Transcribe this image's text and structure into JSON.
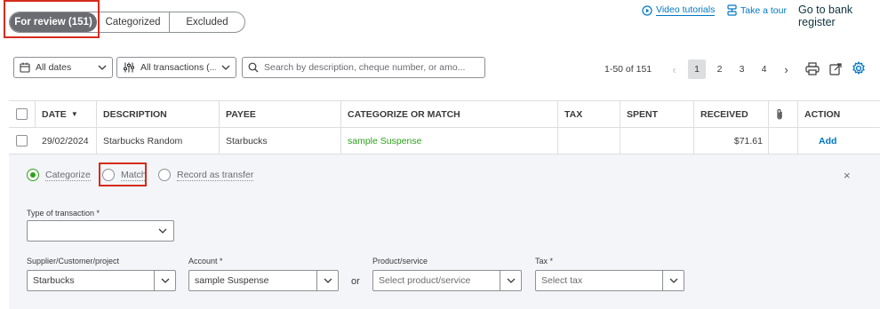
{
  "tabs": [
    {
      "label": "For review (151)"
    },
    {
      "label": "Categorized"
    },
    {
      "label": "Excluded"
    }
  ],
  "header_links": {
    "video_tutorials": "Video tutorials",
    "take_tour": "Take a tour",
    "go_to_bank_register": "Go to bank register"
  },
  "filters": {
    "dates": "All dates",
    "transactions": "All transactions (...",
    "search_placeholder": "Search by description, cheque number, or amo..."
  },
  "pagination": {
    "range": "1-50 of 151",
    "prev": "‹",
    "pages": [
      "1",
      "2",
      "3",
      "4"
    ],
    "current_page": "1",
    "next": "›"
  },
  "table": {
    "columns": {
      "date": "DATE",
      "sort": "▼",
      "description": "DESCRIPTION",
      "payee": "PAYEE",
      "categorize": "CATEGORIZE OR MATCH",
      "tax": "TAX",
      "spent": "SPENT",
      "received": "RECEIVED",
      "action": "ACTION"
    },
    "rows": [
      {
        "date": "29/02/2024",
        "description": "Starbucks Random",
        "payee": "Starbucks",
        "category": "sample Suspense",
        "tax": "",
        "spent": "",
        "received": "$71.61",
        "action": "Add"
      }
    ]
  },
  "panel": {
    "options": [
      "Categorize",
      "Match",
      "Record as transfer"
    ],
    "selected_option": "Categorize",
    "close": "×",
    "type_label": "Type of transaction *",
    "type_value": "",
    "supplier_label": "Supplier/Customer/project",
    "supplier_value": "Starbucks",
    "account_label": "Account *",
    "account_value": "sample Suspense",
    "or_text": "or",
    "product_label": "Product/service",
    "product_placeholder": "Select product/service",
    "tax_label": "Tax *",
    "tax_placeholder": "Select tax"
  },
  "colors": {
    "accent_green": "#2ca01c",
    "link_blue": "#0077c5",
    "highlight_red": "#d52b1e",
    "active_tab": "#6b6c72",
    "panel_bg": "#f4f5f8"
  }
}
